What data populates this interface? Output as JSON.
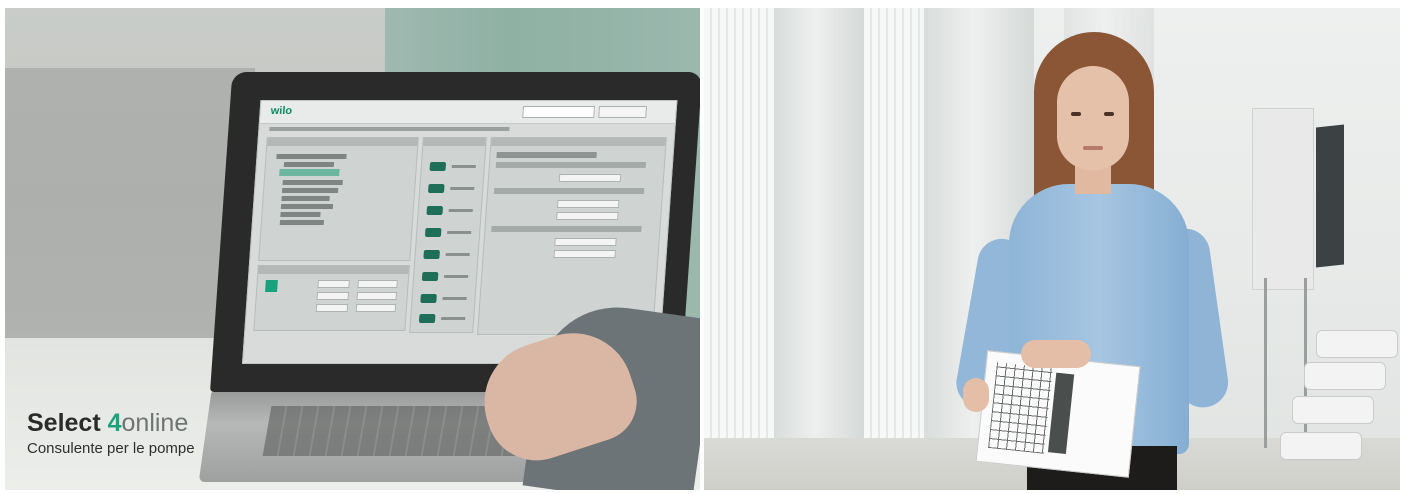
{
  "caption": {
    "brand": "Select ",
    "number": "4",
    "suffix": "online",
    "subtitle": "Consulente per le pompe"
  },
  "screen_app": {
    "logo": "wilo"
  },
  "colors": {
    "accent_green": "#1aa37c",
    "laptop_bezel": "#2b2a2a",
    "shirt_blue": "#9dc0df"
  },
  "images": [
    {
      "name": "laptop-photo"
    },
    {
      "name": "businesswoman-photo"
    }
  ]
}
